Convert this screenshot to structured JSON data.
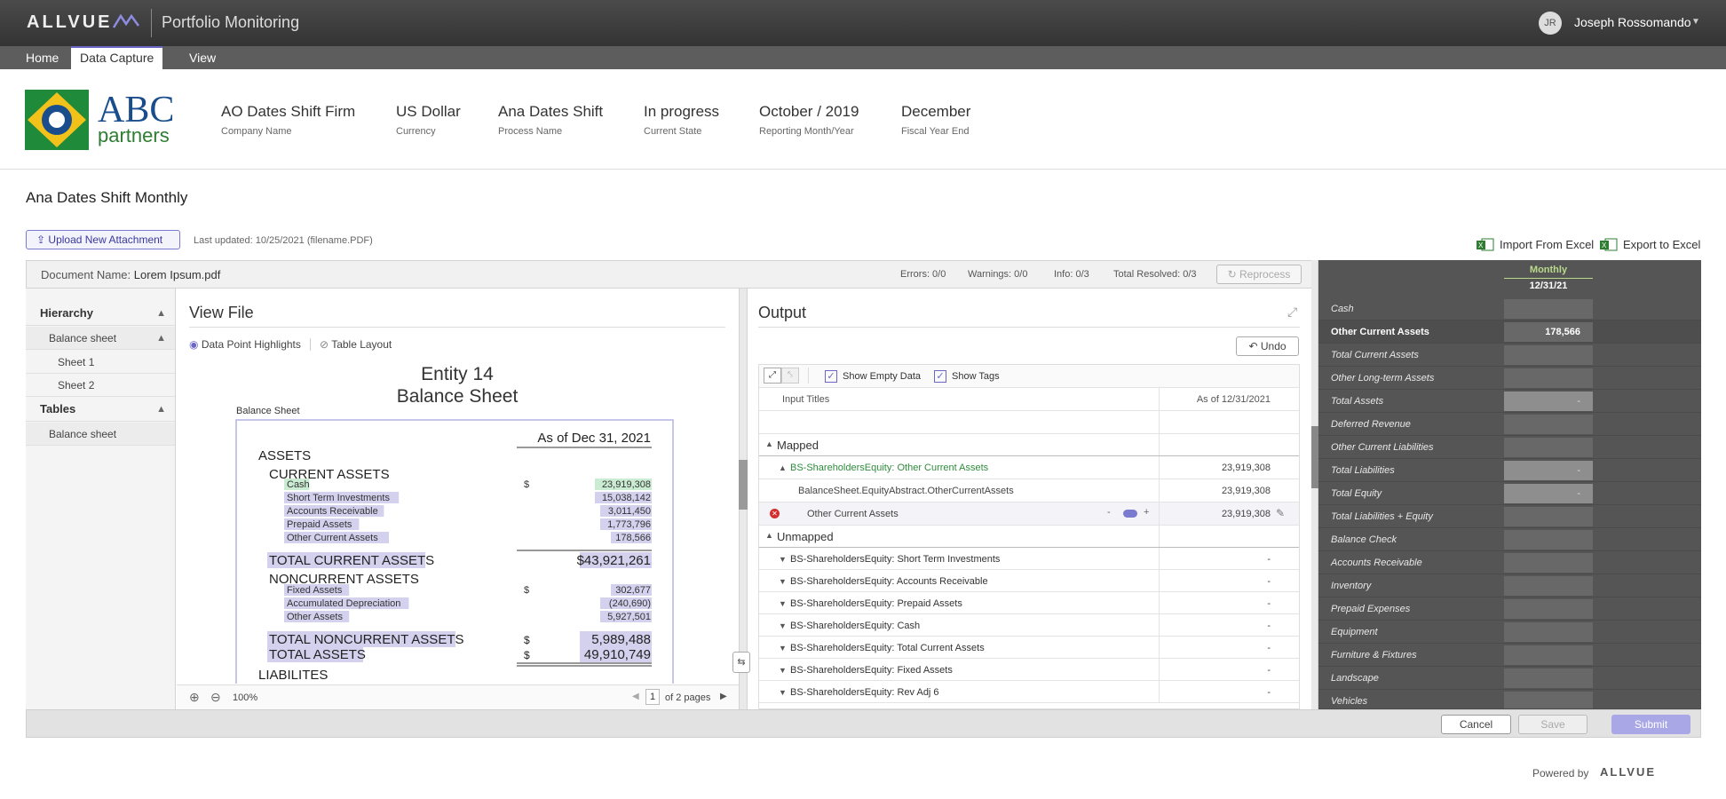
{
  "topbar": {
    "brand": "ALLVUE",
    "app_title": "Portfolio Monitoring",
    "user_initials": "JR",
    "user_name": "Joseph Rossomando"
  },
  "menu": [
    {
      "label": "Home",
      "active": false
    },
    {
      "label": "Data Capture",
      "active": true
    },
    {
      "label": "View",
      "active": false
    }
  ],
  "company_logo": {
    "line1": "ABC",
    "line2": "partners"
  },
  "info": [
    {
      "value": "AO Dates Shift Firm",
      "label": "Company Name"
    },
    {
      "value": "US Dollar",
      "label": "Currency"
    },
    {
      "value": "Ana Dates Shift",
      "label": "Process Name"
    },
    {
      "value": "In progress",
      "label": "Current State"
    },
    {
      "value": "October / 2019",
      "label": "Reporting Month/Year"
    },
    {
      "value": "December",
      "label": "Fiscal Year End"
    }
  ],
  "process_title": "Ana Dates Shift Monthly",
  "upload_label": "Upload New Attachment",
  "last_updated": "Last updated: 10/25/2021 (filename.PDF)",
  "import_label": "Import From Excel",
  "export_label": "Export to Excel",
  "doc_bar": {
    "name_prefix": "Document Name:",
    "name": "Lorem Ipsum.pdf",
    "errors": "Errors: 0/0",
    "warnings": "Warnings: 0/0",
    "info": "Info: 0/3",
    "resolved": "Total Resolved: 0/3",
    "reprocess": "Reprocess"
  },
  "hierarchy": {
    "title": "Hierarchy",
    "group": "Balance sheet",
    "sheets": [
      "Sheet 1",
      "Sheet 2"
    ],
    "tables_title": "Tables",
    "tables": [
      "Balance sheet"
    ]
  },
  "view_file": {
    "title": "View File",
    "highlights": "Data Point Highlights",
    "table_layout": "Table Layout",
    "entity": "Entity 14",
    "doc_title": "Balance Sheet",
    "table_label": "Balance Sheet",
    "as_of": "As of Dec 31, 2021",
    "assets": "ASSETS",
    "current_assets": "CURRENT ASSETS",
    "current_rows": [
      {
        "label": "Cash",
        "cur": "$",
        "value": "23,919,308"
      },
      {
        "label": "Short Term Investments",
        "cur": "",
        "value": "15,038,142"
      },
      {
        "label": "Accounts Receivable",
        "cur": "",
        "value": "3,011,450"
      },
      {
        "label": "Prepaid Assets",
        "cur": "",
        "value": "1,773,796"
      },
      {
        "label": "Other Current Assets",
        "cur": "",
        "value": "178,566"
      }
    ],
    "total_current": {
      "label": "TOTAL CURRENT ASSETS",
      "value": "$43,921,261"
    },
    "noncurrent": "NONCURRENT ASSETS",
    "noncurrent_rows": [
      {
        "label": "Fixed Assets",
        "cur": "$",
        "value": "302,677"
      },
      {
        "label": "Accumulated Depreciation",
        "cur": "",
        "value": "(240,690)"
      },
      {
        "label": "Other Assets",
        "cur": "",
        "value": "5,927,501"
      }
    ],
    "total_noncurrent": {
      "label": "TOTAL NONCURRENT ASSETS",
      "cur": "$",
      "value": "5,989,488"
    },
    "total_assets": {
      "label": "TOTAL ASSETS",
      "cur": "$",
      "value": "49,910,749"
    },
    "liabilities": "LIABILITES",
    "zoom": "100%",
    "page": "1",
    "of_pages": "of 2 pages"
  },
  "output": {
    "title": "Output",
    "undo": "Undo",
    "show_empty": "Show Empty Data",
    "show_tags": "Show Tags",
    "col_titles": "Input Titles",
    "col_date": "As of 12/31/2021",
    "mapped": "Mapped",
    "mapped_row": {
      "prefix": "BS-ShareholdersEquity:",
      "name": "Other Current Assets",
      "value": "23,919,308"
    },
    "tag_row": {
      "name": "BalanceSheet.EquityAbstract.OtherCurrentAssets",
      "value": "23,919,308"
    },
    "input_row": {
      "name": "Other Current Assets",
      "value": "23,919,308"
    },
    "unmapped": "Unmapped",
    "unmapped_rows": [
      {
        "prefix": "BS-ShareholdersEquity:",
        "name": "Short Term Investments",
        "value": "-"
      },
      {
        "prefix": "BS-ShareholdersEquity:",
        "name": "Accounts Receivable",
        "value": "-"
      },
      {
        "prefix": "BS-ShareholdersEquity:",
        "name": "Prepaid Assets",
        "value": "-"
      },
      {
        "prefix": "BS-ShareholdersEquity:",
        "name": "Cash",
        "value": "-"
      },
      {
        "prefix": "BS-ShareholdersEquity:",
        "name": "Total Current Assets",
        "value": "-"
      },
      {
        "prefix": "BS-ShareholdersEquity:",
        "name": "Fixed Assets",
        "value": "-"
      },
      {
        "prefix": "BS-ShareholdersEquity:",
        "name": "Rev Adj 6",
        "value": "-"
      }
    ]
  },
  "right_panel": {
    "period": "Monthly",
    "date": "12/31/21",
    "rows": [
      {
        "label": "Cash",
        "value": "",
        "bold": false,
        "light": false
      },
      {
        "label": "Other Current Assets",
        "value": "178,566",
        "bold": true,
        "light": false
      },
      {
        "label": "Total Current Assets",
        "value": "",
        "bold": false,
        "light": false
      },
      {
        "label": "Other Long-term Assets",
        "value": "",
        "bold": false,
        "light": false
      },
      {
        "label": "Total Assets",
        "value": "-",
        "bold": false,
        "light": true
      },
      {
        "label": "Deferred Revenue",
        "value": "",
        "bold": false,
        "light": false
      },
      {
        "label": "Other Current Liabilities",
        "value": "",
        "bold": false,
        "light": false
      },
      {
        "label": "Total Liabilities",
        "value": "-",
        "bold": false,
        "light": true
      },
      {
        "label": "Total Equity",
        "value": "-",
        "bold": false,
        "light": true
      },
      {
        "label": "Total Liabilities + Equity",
        "value": "",
        "bold": false,
        "light": false
      },
      {
        "label": "Balance Check",
        "value": "",
        "bold": false,
        "light": false
      },
      {
        "label": "Accounts Receivable",
        "value": "",
        "bold": false,
        "light": false
      },
      {
        "label": "Inventory",
        "value": "",
        "bold": false,
        "light": false
      },
      {
        "label": "Prepaid Expenses",
        "value": "",
        "bold": false,
        "light": false
      },
      {
        "label": "Equipment",
        "value": "",
        "bold": false,
        "light": false
      },
      {
        "label": "Furniture & Fixtures",
        "value": "",
        "bold": false,
        "light": false
      },
      {
        "label": "Landscape",
        "value": "",
        "bold": false,
        "light": false
      },
      {
        "label": "Vehicles",
        "value": "",
        "bold": false,
        "light": false
      }
    ]
  },
  "footer": {
    "cancel": "Cancel",
    "save": "Save",
    "submit": "Submit",
    "powered": "Powered by",
    "powered_brand": "ALLVUE"
  },
  "colors": {
    "accent": "#6b67c6",
    "green": "#2e8b3c",
    "highlight": "#d3d1ee"
  }
}
